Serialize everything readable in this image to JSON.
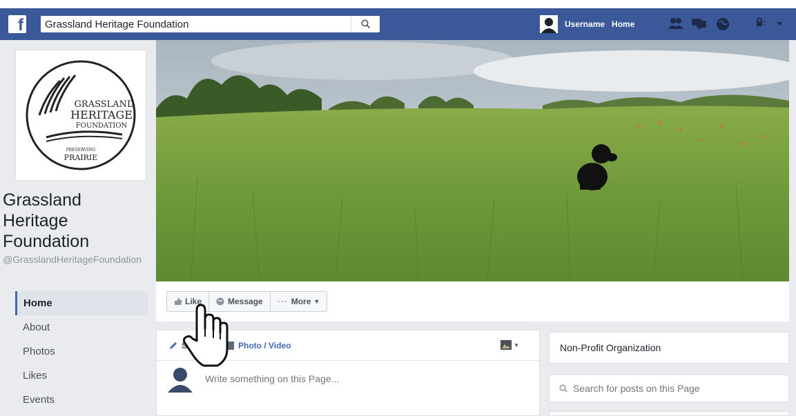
{
  "topbar": {
    "logo": "f",
    "search_value": "Grassland Heritage Foundation",
    "username": "Username",
    "home": "Home",
    "icons": [
      "friends-icon",
      "messages-icon",
      "notifications-globe-icon",
      "account-menu-icon"
    ]
  },
  "page": {
    "logo_lines": [
      "GRASSLAND",
      "HERITAGE",
      "FOUNDATION",
      "PRESERVING",
      "PRAIRIE"
    ],
    "name": "Grassland Heritage Foundation",
    "handle": "@GrasslandHeritageFoundation"
  },
  "sidebar": {
    "items": [
      {
        "label": "Home"
      },
      {
        "label": "About"
      },
      {
        "label": "Photos"
      },
      {
        "label": "Likes"
      },
      {
        "label": "Events"
      }
    ]
  },
  "actions": {
    "like": "Like",
    "message": "Message",
    "more": "More"
  },
  "composer": {
    "status_tab": "S",
    "photo_tab": "Photo / Video",
    "placeholder": "Write something on this Page..."
  },
  "right": {
    "category": "Non-Profit Organization",
    "search_placeholder": "Search for posts on this Page"
  },
  "colors": {
    "brand": "#3b5998",
    "accent": "#4267b2"
  }
}
